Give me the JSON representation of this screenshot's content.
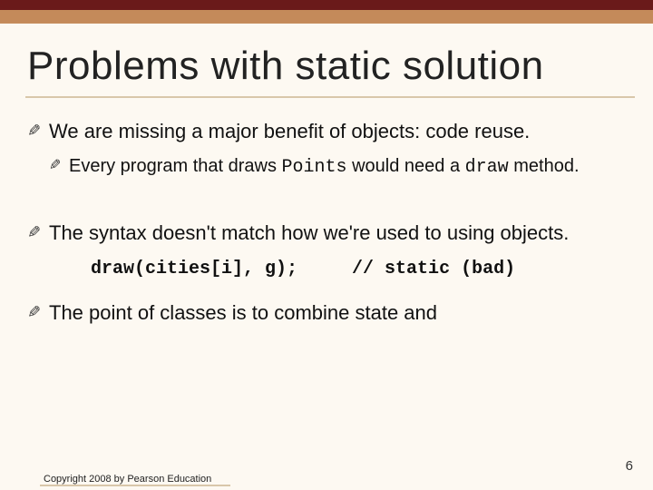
{
  "slide": {
    "title": "Problems with static solution",
    "bullets": [
      {
        "level": 1,
        "html": "We are missing a major benefit of objects: code reuse."
      },
      {
        "level": 2,
        "html": "Every program that draws <span class=\"mono\">Points</span> would need a <span class=\"mono\">draw</span> method."
      },
      {
        "level": 1,
        "html": "The syntax doesn't match how we're used to using objects."
      },
      {
        "code": "draw(cities[i], g);     // static (bad)"
      },
      {
        "level": 1,
        "html": "The point of classes is to combine state and"
      }
    ],
    "footer": "Copyright 2008 by Pearson Education",
    "page_number": "6"
  }
}
